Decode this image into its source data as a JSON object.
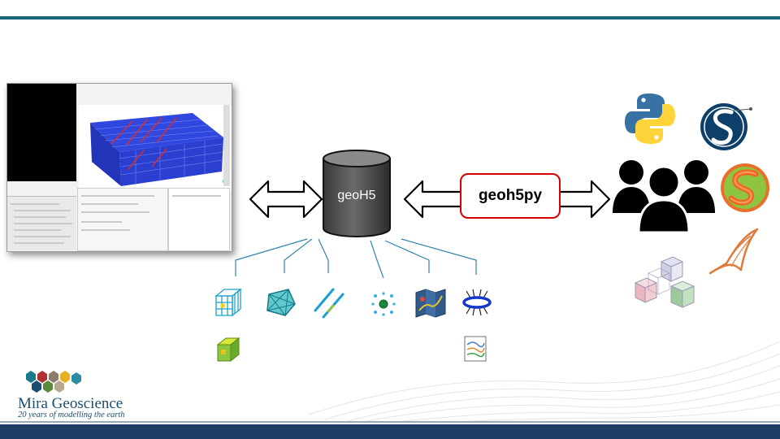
{
  "diagram": {
    "database_label": "geoH5",
    "api_label": "geoh5py"
  },
  "logo": {
    "name": "Mira Geoscience",
    "tagline": "20 years of modelling the earth"
  },
  "colors": {
    "top_bar": "#17667a",
    "bottom_bar": "#1d3f66",
    "api_border": "#d90000",
    "connector": "#2e86b0"
  },
  "icons": {
    "right": [
      "python-logo-icon",
      "scikit-learn-logo-icon",
      "users-group-icon",
      "scipy-logo-icon",
      "paraview-logo-icon",
      "matlab-logo-icon"
    ],
    "bottom": [
      "block-model-icon",
      "surface-mesh-icon",
      "drillhole-icon",
      "points-icon",
      "geo-image-icon",
      "survey-loop-icon",
      "octree-icon",
      "data-profile-icon"
    ]
  }
}
